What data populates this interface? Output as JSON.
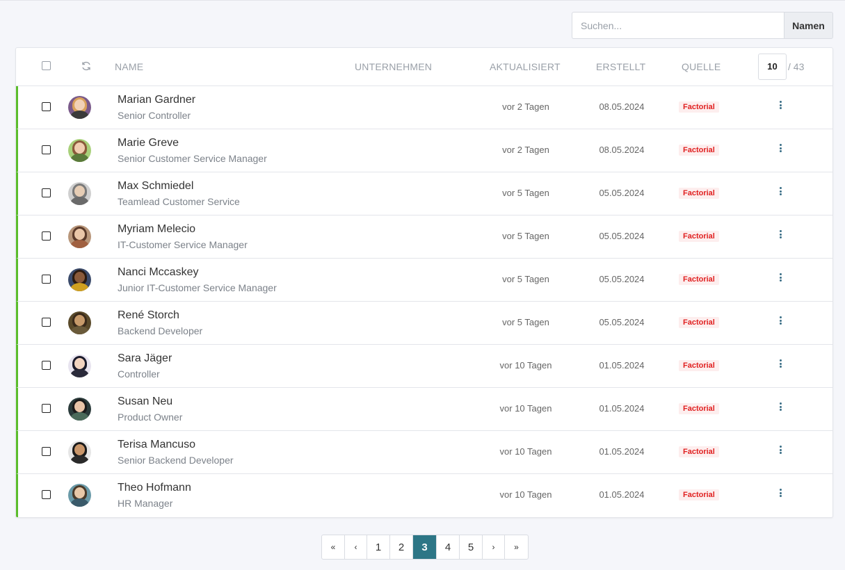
{
  "search": {
    "placeholder": "Suchen...",
    "button_label": "Namen"
  },
  "table": {
    "columns": {
      "name": "NAME",
      "company": "UNTERNEHMEN",
      "updated": "AKTUALISIERT",
      "created": "ERSTELLT",
      "source": "QUELLE"
    },
    "page_size": "10",
    "total": "/ 43",
    "rows": [
      {
        "name": "Marian Gardner",
        "title": "Senior Controller",
        "updated": "vor 2 Tagen",
        "created": "08.05.2024",
        "source": "Factorial"
      },
      {
        "name": "Marie Greve",
        "title": "Senior Customer Service Manager",
        "updated": "vor 2 Tagen",
        "created": "08.05.2024",
        "source": "Factorial"
      },
      {
        "name": "Max Schmiedel",
        "title": "Teamlead Customer Service",
        "updated": "vor 5 Tagen",
        "created": "05.05.2024",
        "source": "Factorial"
      },
      {
        "name": "Myriam Melecio",
        "title": "IT-Customer Service Manager",
        "updated": "vor 5 Tagen",
        "created": "05.05.2024",
        "source": "Factorial"
      },
      {
        "name": "Nanci Mccaskey",
        "title": "Junior IT-Customer Service Manager",
        "updated": "vor 5 Tagen",
        "created": "05.05.2024",
        "source": "Factorial"
      },
      {
        "name": "René Storch",
        "title": "Backend Developer",
        "updated": "vor 5 Tagen",
        "created": "05.05.2024",
        "source": "Factorial"
      },
      {
        "name": "Sara Jäger",
        "title": "Controller",
        "updated": "vor 10 Tagen",
        "created": "01.05.2024",
        "source": "Factorial"
      },
      {
        "name": "Susan Neu",
        "title": "Product Owner",
        "updated": "vor 10 Tagen",
        "created": "01.05.2024",
        "source": "Factorial"
      },
      {
        "name": "Terisa Mancuso",
        "title": "Senior Backend Developer",
        "updated": "vor 10 Tagen",
        "created": "01.05.2024",
        "source": "Factorial"
      },
      {
        "name": "Theo Hofmann",
        "title": "HR Manager",
        "updated": "vor 10 Tagen",
        "created": "01.05.2024",
        "source": "Factorial"
      }
    ]
  },
  "pagination": {
    "first": "«",
    "prev": "‹",
    "pages": [
      "1",
      "2",
      "3",
      "4",
      "5"
    ],
    "next": "›",
    "last": "»",
    "current": "3"
  },
  "colors": {
    "accent": "#2d7686",
    "row_marker": "#5bbd2b",
    "source_badge": "#e02020"
  }
}
